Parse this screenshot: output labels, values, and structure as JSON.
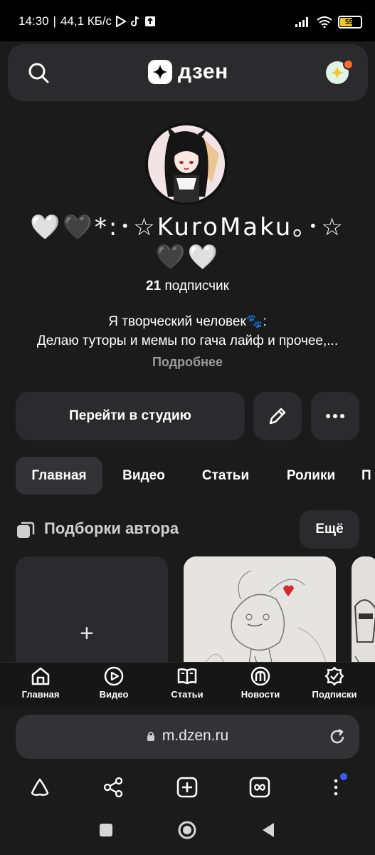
{
  "status_bar": {
    "time": "14:30",
    "network_speed": "44,1 КБ/с",
    "battery_level": "55"
  },
  "header": {
    "logo_text": "дзен",
    "icons": [
      "search-icon",
      "dzen-star-icon",
      "sparkle-avatar-icon"
    ]
  },
  "profile": {
    "name": "🤍🖤*:･☆KuroMaku｡･☆🖤🤍",
    "subscribers_count": "21",
    "subscribers_label": "подписчик",
    "description_line1": "Я творческий человек🐾:",
    "description_line2": "Делаю туторы и мемы по гача лайф и прочее,...",
    "more_label": "Подробнее"
  },
  "actions": {
    "studio_label": "Перейти в студию",
    "edit_icon": "pencil-icon",
    "more_icon": "ellipsis-icon"
  },
  "tabs": [
    {
      "label": "Главная",
      "active": true
    },
    {
      "label": "Видео",
      "active": false
    },
    {
      "label": "Статьи",
      "active": false
    },
    {
      "label": "Ролики",
      "active": false
    },
    {
      "label": "П",
      "active": false
    }
  ],
  "collections": {
    "title": "Подборки автора",
    "all_label": "Ещё",
    "new_card_icon": "+"
  },
  "bottom_nav": [
    {
      "label": "Главная",
      "icon": "home-icon"
    },
    {
      "label": "Видео",
      "icon": "play-icon"
    },
    {
      "label": "Статьи",
      "icon": "book-icon"
    },
    {
      "label": "Новости",
      "icon": "news-icon"
    },
    {
      "label": "Подписки",
      "icon": "subscriptions-icon"
    }
  ],
  "browser": {
    "url": "m.dzen.ru",
    "toolbar_icons": [
      "alice-icon",
      "share-icon",
      "new-tab-icon",
      "tabs-icon",
      "menu-dots-icon"
    ]
  },
  "colors": {
    "background": "#1b1b1c",
    "surface": "#2b2b2d",
    "accent_dot": "#ff6a2b",
    "menu_badge": "#3d5afe"
  }
}
